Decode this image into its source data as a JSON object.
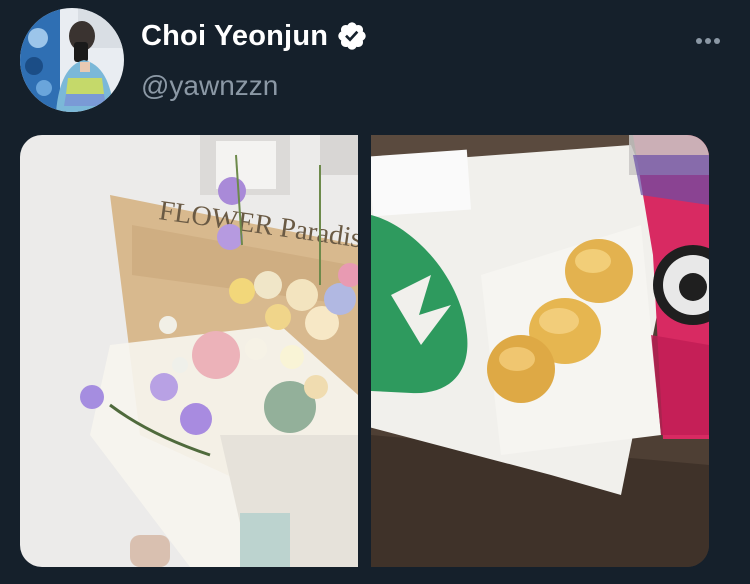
{
  "tweet": {
    "author": {
      "display_name": "Choi Yeonjun",
      "handle": "@yawnzzn",
      "verified": true
    },
    "more_icon": "more-horizontal-icon",
    "media": [
      {
        "name": "bouquet-photo",
        "printed_text": "FLOWER Paradise"
      },
      {
        "name": "cafe-photo",
        "printed_text": ""
      }
    ]
  },
  "colors": {
    "background": "#15202b",
    "name_text": "#ffffff",
    "secondary_text": "#8b98a5",
    "verified_badge": "#ffffff"
  }
}
